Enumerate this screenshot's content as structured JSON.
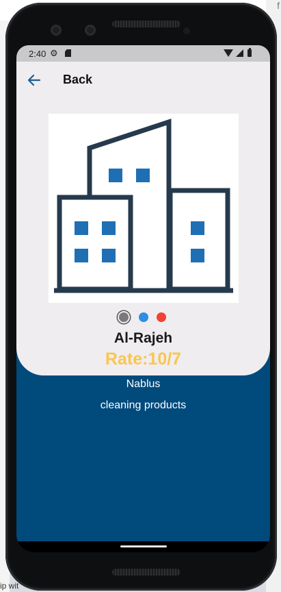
{
  "status_bar": {
    "time": "2:40"
  },
  "header": {
    "back_label": "Back"
  },
  "carousel": {
    "slide_count": 3,
    "active_index": 0,
    "dot_colors": [
      "#7a7a7a",
      "#2f8de4",
      "#f14236"
    ]
  },
  "store": {
    "name": "Al-Rajeh",
    "rate": "Rate:10/7",
    "city": "Nablus",
    "category": "cleaning products"
  },
  "background": {
    "bottom_left_text": "ip wit",
    "right_glyph": "f"
  },
  "colors": {
    "card": "#efedf0",
    "screen_bg": "#004a7c",
    "rate": "#f8c651",
    "building_outline": "#263a4d",
    "building_window": "#1f6fb4"
  },
  "icons": [
    "back-arrow-icon",
    "settings-gear-icon",
    "sd-card-icon",
    "wifi-icon",
    "cell-signal-icon",
    "battery-icon",
    "building-image"
  ]
}
